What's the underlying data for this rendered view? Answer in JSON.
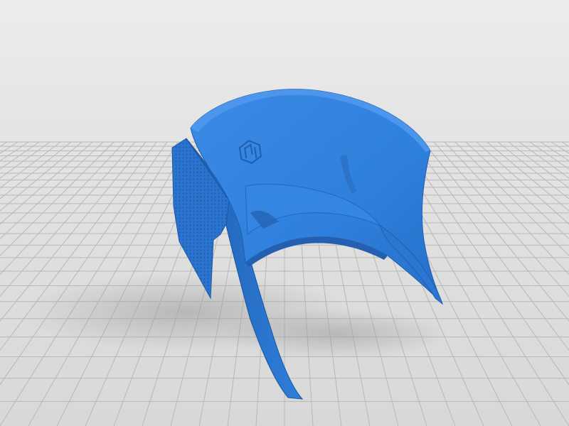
{
  "scene": {
    "background_color": "#e3e3e3",
    "grid_line_color": "#b8b8b8",
    "model_color": "#2f7fdc",
    "model_shadow_color": "#1f5fb0",
    "model_highlight_color": "#5a9ff0",
    "logo_icon": "hexagon-logo-icon"
  }
}
